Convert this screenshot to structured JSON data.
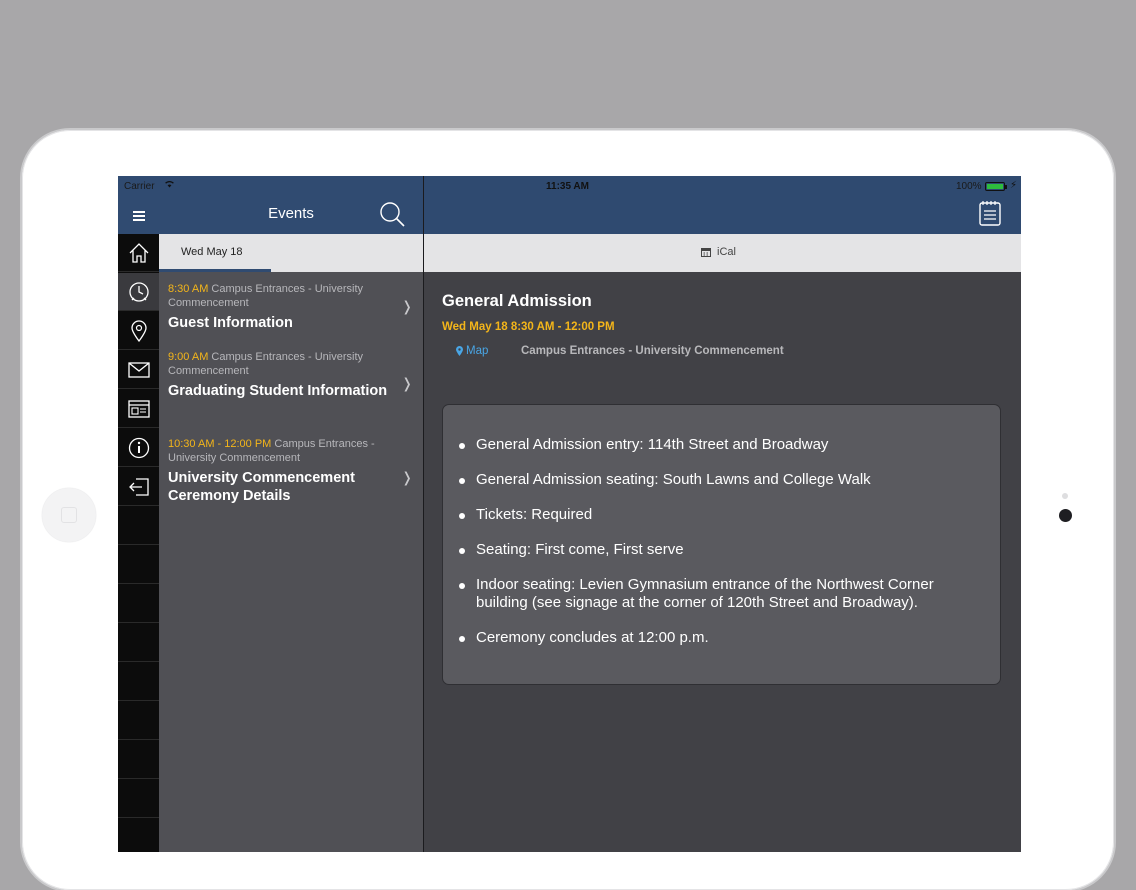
{
  "status_bar": {
    "carrier": "Carrier",
    "time": "11:35 AM",
    "battery": "100%"
  },
  "header": {
    "title": "Events"
  },
  "date_tab": {
    "label": "Wed  May 18"
  },
  "ical": {
    "label": "iCal"
  },
  "sidebar": {
    "items": [
      {
        "name": "home-icon"
      },
      {
        "name": "clock-icon"
      },
      {
        "name": "map-pin-icon"
      },
      {
        "name": "mail-icon"
      },
      {
        "name": "web-icon"
      },
      {
        "name": "info-icon"
      },
      {
        "name": "logout-icon"
      }
    ]
  },
  "events": [
    {
      "time": "8:30 AM",
      "location": " Campus Entrances - University Commencement",
      "name": "Guest Information"
    },
    {
      "time": "9:00 AM",
      "location": " Campus Entrances - University Commencement",
      "name": "Graduating Student Information"
    },
    {
      "time": "10:30 AM - 12:00 PM",
      "location": " Campus Entrances - University Commencement",
      "name": "University Commencement Ceremony Details"
    }
  ],
  "detail": {
    "title": "General Admission",
    "when": "Wed May 18 8:30 AM - 12:00 PM",
    "map_label": "Map",
    "location": "Campus Entrances - University Commencement",
    "bullets": [
      "General Admission entry:  114th Street and Broadway",
      "General Admission seating:  South Lawns and College Walk",
      "Tickets:  Required",
      "Seating:  First come, First serve",
      "Indoor seating:  Levien Gymnasium entrance of the Northwest Corner building (see signage at the corner of 120th Street and Broadway).",
      "Ceremony concludes at 12:00 p.m."
    ]
  },
  "colors": {
    "header": "#304b71",
    "accent_time": "#f3b51a",
    "map_link": "#49a6e6"
  }
}
